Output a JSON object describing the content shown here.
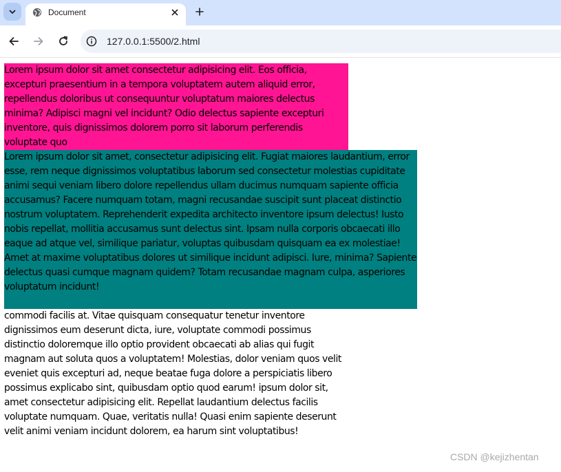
{
  "tab": {
    "title": "Document",
    "favicon": "globe-icon"
  },
  "toolbar": {
    "url": "127.0.0.1:5500/2.html",
    "site_info_icon": "info-icon"
  },
  "colors": {
    "pink_box": "#ff1493",
    "teal_box": "#008080",
    "tabstrip": "#d3e3fd",
    "omnibox": "#eef2f9"
  },
  "page": {
    "paragraph_pink": "Lorem ipsum dolor sit amet consectetur adipisicing elit. Eos officia, excepturi praesentium in a tempora voluptatem autem aliquid error, repellendus doloribus ut consequuntur voluptatum maiores delectus minima? Adipisci magni vel incidunt? Odio delectus sapiente excepturi inventore, quis dignissimos dolorem porro sit laborum perferendis voluptate quo",
    "paragraph_teal": "Lorem ipsum dolor sit amet, consectetur adipisicing elit. Fugiat maiores laudantium, error esse, rem neque dignissimos voluptatibus laborum sed consectetur molestias cupiditate animi sequi veniam libero dolore repellendus ullam ducimus numquam sapiente officia accusamus? Facere numquam totam, magni recusandae suscipit sunt placeat distinctio nostrum voluptatem. Reprehenderit expedita architecto inventore ipsum delectus! Iusto nobis repellat, mollitia accusamus sunt delectus sint. Ipsam nulla corporis obcaecati illo eaque ad atque vel, similique pariatur, voluptas quibusdam quisquam ea ex molestiae! Amet at maxime voluptatibus dolores ut similique incidunt adipisci. Iure, minima? Sapiente delectus quasi cumque magnam quidem? Totam recusandae magnam culpa, asperiores voluptatum incidunt!",
    "paragraph_plain": "commodi facilis at. Vitae quisquam consequatur tenetur inventore dignissimos eum deserunt dicta, iure, voluptate commodi possimus distinctio doloremque illo optio provident obcaecati ab alias qui fugit magnam aut soluta quos a voluptatem! Molestias, dolor veniam quos velit eveniet quis excepturi ad, neque beatae fuga dolore a perspiciatis libero possimus explicabo sint, quibusdam optio quod earum! ipsum dolor sit, amet consectetur adipisicing elit. Repellat laudantium delectus facilis voluptate numquam. Quae, veritatis nulla! Quasi enim sapiente deserunt velit animi veniam incidunt dolorem, ea harum sint voluptatibus!"
  },
  "watermark": "CSDN @kejizhentan"
}
